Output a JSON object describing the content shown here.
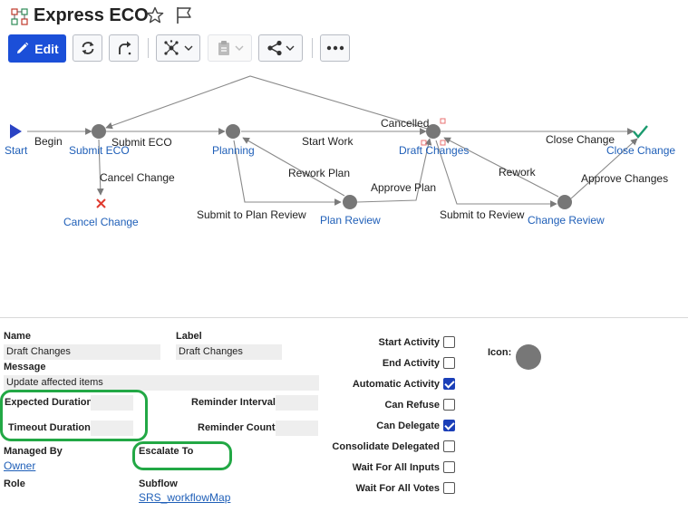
{
  "header": {
    "title": "Express ECO",
    "edit_label": "Edit"
  },
  "colors": {
    "accent": "#1b4fd8",
    "link": "#1f5fb8",
    "node": "#777777",
    "highlight": "#22a845",
    "cancel": "#e03a2f",
    "complete": "#1a9a6e"
  },
  "icons": [
    "workflow-map-icon",
    "star-icon",
    "flag-icon",
    "pencil-icon",
    "refresh-icon",
    "route-icon",
    "network-icon",
    "clipboard-icon",
    "share-icon",
    "more-icon"
  ],
  "workflow": {
    "nodes": {
      "start": "Start",
      "submit_eco": "Submit ECO",
      "cancel_change": "Cancel Change",
      "planning": "Planning",
      "plan_review": "Plan Review",
      "draft_changes": "Draft Changes",
      "change_review": "Change Review",
      "close_change": "Close Change"
    },
    "paths": {
      "begin": "Begin",
      "submit_eco": "Submit ECO",
      "cancel_change": "Cancel Change",
      "start_work": "Start Work",
      "rework_plan": "Rework Plan",
      "submit_plan_review": "Submit to Plan Review",
      "approve_plan": "Approve Plan",
      "cancelled": "Cancelled",
      "close_change": "Close Change",
      "rework": "Rework",
      "submit_review": "Submit to Review",
      "approve_changes": "Approve Changes"
    }
  },
  "props": {
    "name_label": "Name",
    "name_value": "Draft Changes",
    "label_label": "Label",
    "label_value": "Draft Changes",
    "message_label": "Message",
    "message_value": "Update affected items",
    "expected_duration_label": "Expected Duration",
    "expected_duration_value": "",
    "timeout_duration_label": "Timeout Duration",
    "timeout_duration_value": "",
    "reminder_interval_label": "Reminder Interval",
    "reminder_interval_value": "",
    "reminder_count_label": "Reminder Count",
    "reminder_count_value": "",
    "managed_by_label": "Managed By",
    "managed_by_value": "Owner",
    "escalate_to_label": "Escalate To",
    "role_label": "Role",
    "subflow_label": "Subflow",
    "subflow_value": "SRS_workflowMap",
    "icon_label": "Icon:",
    "checks": [
      {
        "label": "Start Activity",
        "checked": false
      },
      {
        "label": "End Activity",
        "checked": false
      },
      {
        "label": "Automatic Activity",
        "checked": true
      },
      {
        "label": "Can Refuse",
        "checked": false
      },
      {
        "label": "Can Delegate",
        "checked": true
      },
      {
        "label": "Consolidate Delegated",
        "checked": false
      },
      {
        "label": "Wait For All Inputs",
        "checked": false
      },
      {
        "label": "Wait For All Votes",
        "checked": false
      }
    ]
  }
}
